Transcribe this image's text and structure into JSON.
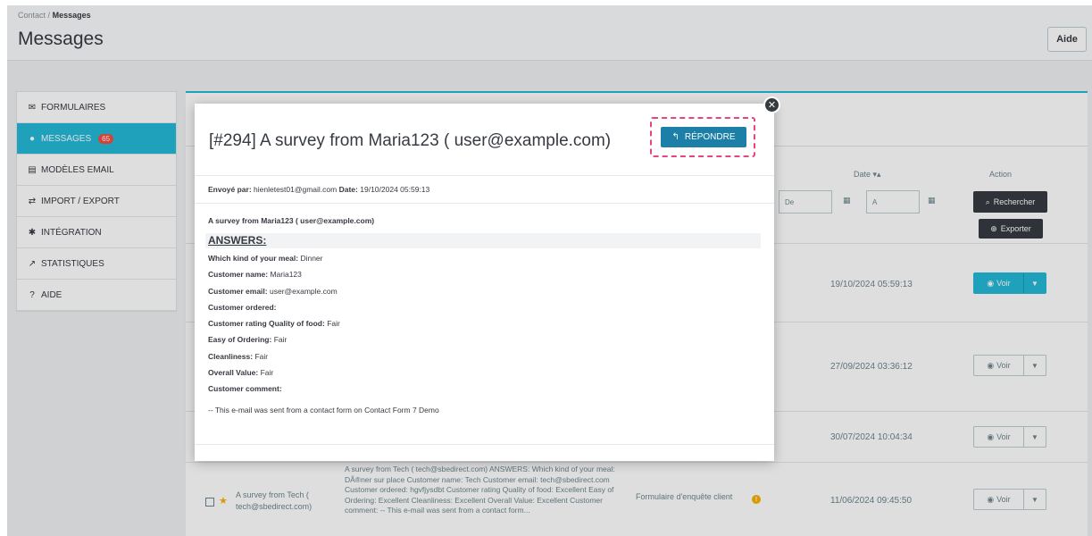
{
  "breadcrumb": {
    "parent": "Contact",
    "sep": "/",
    "current": "Messages"
  },
  "page_title": "Messages",
  "help_label": "Aide",
  "sidebar": {
    "items": [
      {
        "icon": "✉",
        "label": "FORMULAIRES"
      },
      {
        "icon": "●",
        "label": "MESSAGES",
        "badge": "65"
      },
      {
        "icon": "▤",
        "label": "MODÈLES EMAIL"
      },
      {
        "icon": "⇄",
        "label": "IMPORT / EXPORT"
      },
      {
        "icon": "✱",
        "label": "INTÉGRATION"
      },
      {
        "icon": "↗",
        "label": "STATISTIQUES"
      },
      {
        "icon": "?",
        "label": "AIDE"
      }
    ]
  },
  "table": {
    "date_header": "Date ▾▴",
    "action_header": "Action",
    "filter_from": "De",
    "filter_to": "A",
    "search_label": "Rechercher",
    "export_label": "Exporter",
    "view_label": "Voir",
    "rows": [
      {
        "date": "19/10/2024 05:59:13"
      },
      {
        "date": "27/09/2024 03:36:12"
      },
      {
        "date": "30/07/2024 10:04:34"
      },
      {
        "date": "11/06/2024 09:45:50",
        "name": "A survey from Tech ( tech@sbedirect.com)",
        "message": "A survey from Tech ( tech@sbedirect.com) ANSWERS: Which kind of your meal: DÃ®ner sur place Customer name: Tech Customer email: tech@sbedirect.com Customer ordered: hgvfjysdbt Customer rating Quality of food: Excellent Easy of Ordering: Excellent Cleanliness: Excellent Overall Value: Excellent Customer comment: -- This e-mail was sent from a contact form...",
        "form": "Formulaire d'enquête client"
      }
    ]
  },
  "modal": {
    "title": "[#294] A survey from Maria123 ( user@example.com)",
    "reply_label": "RÉPONDRE",
    "sent_by_label": "Envoyé par:",
    "sent_by_value": "hienletest01@gmail.com",
    "date_label": "Date:",
    "date_value": "19/10/2024 05:59:13",
    "subject": "A survey from Maria123 ( user@example.com)",
    "answers_heading": "ANSWERS:",
    "fields": [
      {
        "label": "Which kind of your meal:",
        "value": "Dinner"
      },
      {
        "label": "Customer name:",
        "value": "Maria123"
      },
      {
        "label": "Customer email:",
        "value": "user@example.com"
      },
      {
        "label": "Customer ordered:",
        "value": ""
      },
      {
        "label": "Customer rating Quality of food:",
        "value": "Fair"
      },
      {
        "label": "Easy of Ordering:",
        "value": "Fair"
      },
      {
        "label": "Cleanliness:",
        "value": "Fair"
      },
      {
        "label": "Overall Value:",
        "value": "Fair"
      },
      {
        "label": "Customer comment:",
        "value": ""
      }
    ],
    "footer_note": "-- This e-mail was sent from a contact form on Contact Form 7 Demo"
  },
  "colors": {
    "accent": "#25b9d7",
    "reply": "#1b7fa8",
    "highlight_border": "#e5467b",
    "badge": "#f54c3e"
  }
}
